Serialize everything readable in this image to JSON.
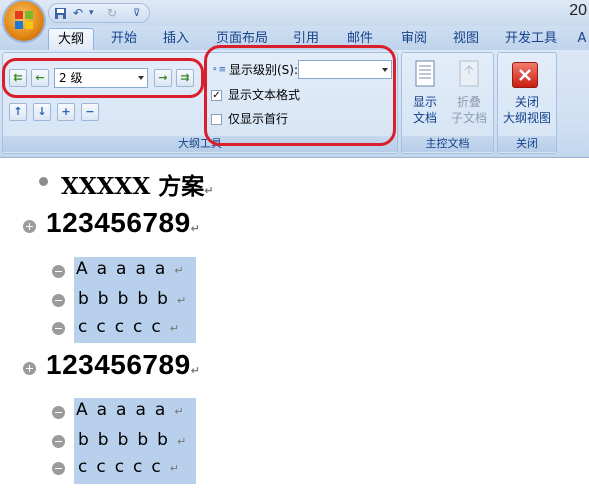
{
  "window": {
    "title_partial": "20"
  },
  "tabs": [
    "大纲",
    "开始",
    "插入",
    "页面布局",
    "引用",
    "邮件",
    "审阅",
    "视图",
    "开发工具",
    "A"
  ],
  "outline_tools": {
    "level_value": "2 级",
    "show_level_label": "显示级别(S):",
    "show_level_value": "",
    "show_text_formatting_label": "显示文本格式",
    "show_text_formatting_checked": true,
    "show_first_line_label": "仅显示首行",
    "show_first_line_checked": false,
    "group_label": "大纲工具"
  },
  "master_document": {
    "show_document_label_1": "显示",
    "show_document_label_2": "文档",
    "collapse_label_1": "折叠",
    "collapse_label_2": "子文档",
    "group_label": "主控文档"
  },
  "close_group": {
    "close_label_1": "关闭",
    "close_label_2": "大纲视图",
    "group_label": "关闭"
  },
  "document": {
    "title": "XXXXX 方案",
    "headings": [
      {
        "text": "123456789",
        "subitems": [
          "Aaaaa",
          "bbbbb",
          "ccccc"
        ]
      },
      {
        "text": "123456789",
        "subitems": [
          "Aaaaa",
          "bbbbb",
          "ccccc"
        ]
      }
    ],
    "para_mark": "↵"
  },
  "colors": {
    "highlight": "#b8d0ec",
    "ribbon": "#d4e3f4",
    "annotation_red": "#d91f2c"
  }
}
